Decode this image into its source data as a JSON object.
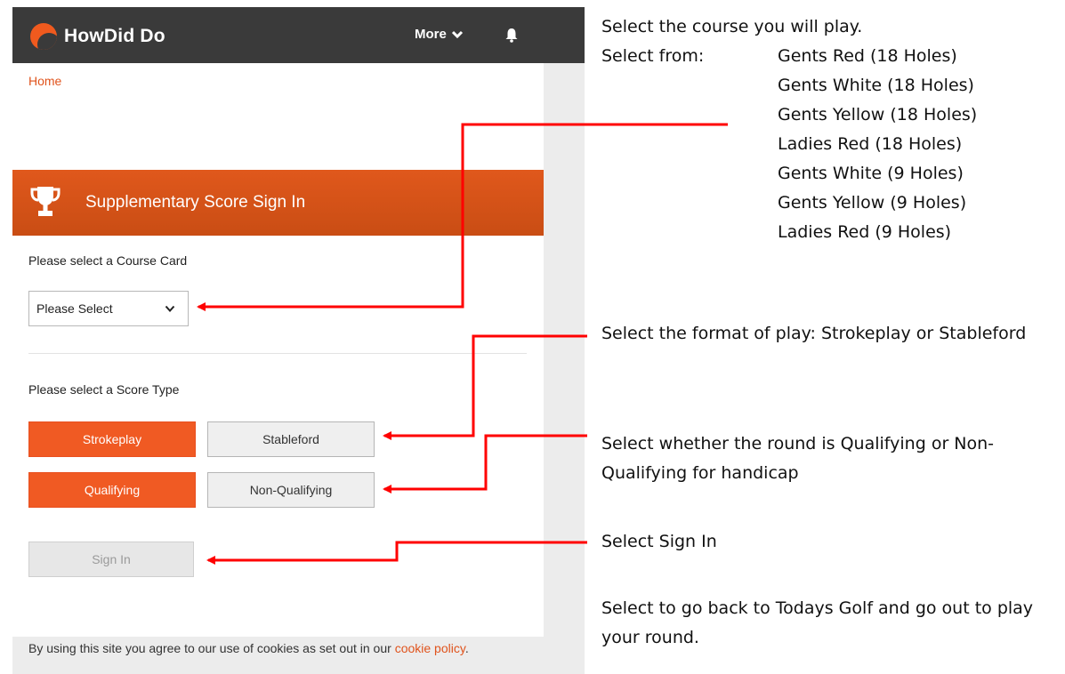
{
  "app": {
    "logo_text": "HowDid Do",
    "more_label": "More",
    "breadcrumb": "Home",
    "banner_title": "Supplementary Score Sign In",
    "course_card_label": "Please select a Course Card",
    "course_select_value": "Please Select",
    "score_type_label": "Please select a Score Type",
    "buttons": {
      "strokeplay": "Strokeplay",
      "stableford": "Stableford",
      "qualifying": "Qualifying",
      "non_qualifying": "Non-Qualifying",
      "sign_in": "Sign In"
    },
    "cookie_text": "By using this site you agree to our use of cookies as set out in our",
    "cookie_link": "cookie policy",
    "cookie_end": "."
  },
  "annotations": {
    "course": "Select the course you will play.",
    "select_from": "Select from:",
    "course_options": [
      "Gents Red (18 Holes)",
      "Gents White (18 Holes)",
      "Gents Yellow (18 Holes)",
      "Ladies Red (18 Holes)",
      "Gents White (9 Holes)",
      "Gents Yellow (9 Holes)",
      "Ladies Red (9 Holes)"
    ],
    "format": "Select the format of play: Strokeplay or Stableford",
    "qualifying": "Select whether the round is Qualifying or Non-Qualifying for handicap",
    "sign_in": "Select Sign In",
    "back": "Select to go back to Todays Golf and go out to play your round."
  },
  "colors": {
    "accent": "#f05a23",
    "topbar": "#3a3a3a",
    "arrow": "#ff0000"
  },
  "icons": [
    "logo-mark-icon",
    "chevron-down-icon",
    "bell-icon",
    "trophy-icon"
  ]
}
